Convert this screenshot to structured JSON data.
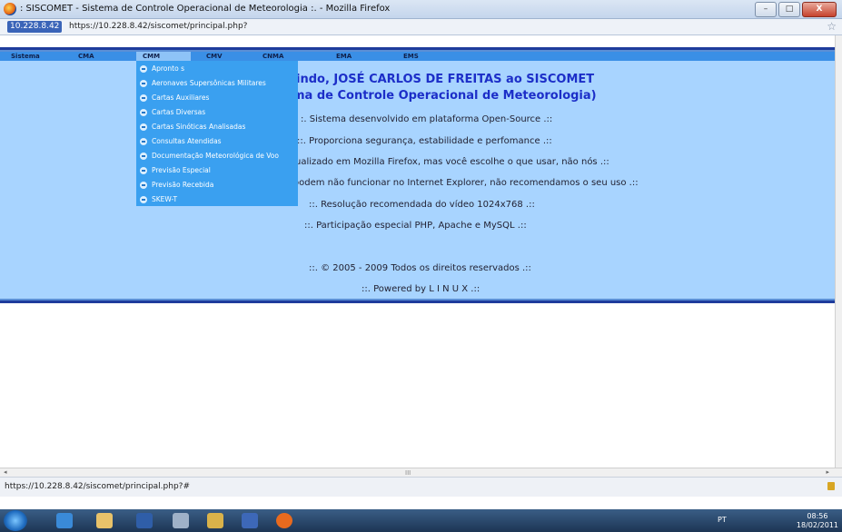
{
  "window": {
    "title": ": SISCOMET - Sistema de Controle Operacional de Meteorologia :. - Mozilla Firefox",
    "controls": [
      "–",
      "□",
      "X"
    ]
  },
  "address": {
    "site_identity": "10.228.8.42",
    "url": "https://10.228.8.42/siscomet/principal.php?"
  },
  "nav": {
    "items": [
      "Sistema",
      "CMA",
      "CMM",
      "CMV",
      "CNMA",
      "EMA",
      "EMS"
    ],
    "active": "CMM"
  },
  "dropdown": {
    "items": [
      "Apronto s",
      "Aeronaves Supersônicas Militares",
      "Cartas Auxiliares",
      "Cartas Diversas",
      "Cartas Sinóticas Analisadas",
      "Consultas Atendidas",
      "Documentação Meteorológica de Voo",
      "Previsão Especial",
      "Previsão Recebida",
      "SKEW-T"
    ]
  },
  "welcome": {
    "line1": "indo, JOSÉ CARLOS DE FREITAS ao SISCOMET",
    "line2": "ma de Controle Operacional de Meteorologia)"
  },
  "info_lines": [
    ":. Sistema desenvolvido em plataforma Open-Source .::",
    "::. Proporciona segurança, estabilidade e perfomance .::",
    "ualizado em Mozilla Firefox, mas você escolhe o que usar, não nós .::",
    "oodem não funcionar no Internet Explorer, não recomendamos o seu uso .::",
    "::. Resolução recomendada do vídeo 1024x768 .::",
    "::. Participação especial PHP, Apache e MySQL .::"
  ],
  "footer_lines": [
    "::. © 2005 - 2009 Todos os direitos reservados .::",
    "::. Powered by L I N U X .::"
  ],
  "status": {
    "text": "https://10.228.8.42/siscomet/principal.php?#"
  },
  "taskbar": {
    "lang": "PT",
    "time": "08:56",
    "date": "18/02/2011"
  },
  "scroll": {
    "grip": "III"
  }
}
